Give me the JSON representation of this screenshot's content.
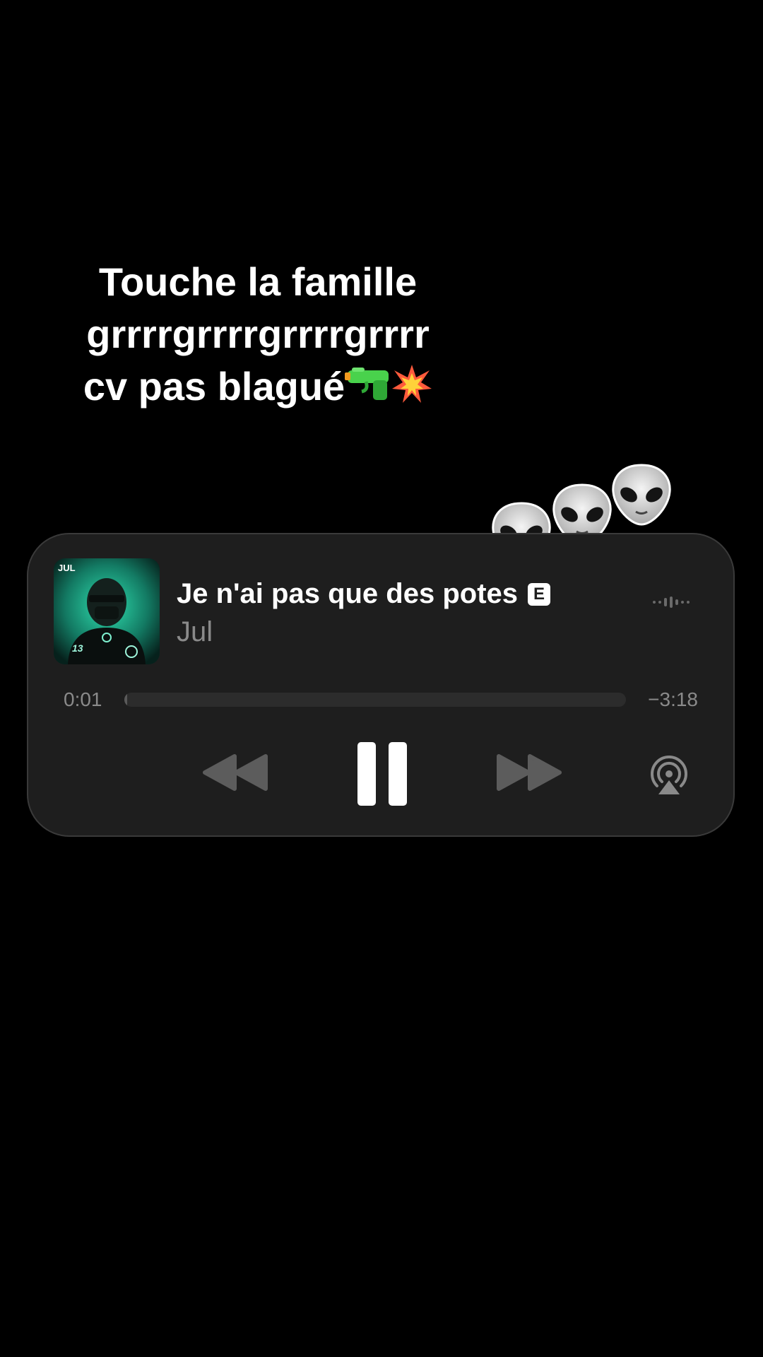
{
  "caption": {
    "line1": "Touche la famille",
    "line2": "grrrrgrrrrgrrrrgrrrr",
    "line3": "cv pas blagué"
  },
  "decorations": {
    "caption_emojis": [
      "water-pistol",
      "collision"
    ],
    "aliens_count": 3
  },
  "now_playing": {
    "title": "Je n'ai pas que des potes",
    "explicit_badge": "E",
    "artist": "Jul",
    "artwork_text": "JUL",
    "artwork_number": "13",
    "elapsed": "0:01",
    "remaining": "−3:18",
    "progress_fraction": 0.005,
    "state": "playing"
  },
  "controls": {
    "rewind_icon": "backward-icon",
    "pause_icon": "pause-icon",
    "forward_icon": "forward-icon",
    "airplay_icon": "airplay-icon"
  },
  "colors": {
    "background": "#000000",
    "card": "#1e1e1e",
    "primary_text": "#ffffff",
    "secondary_text": "#8a8a8a",
    "artwork_accent": "#2fe0b0"
  }
}
